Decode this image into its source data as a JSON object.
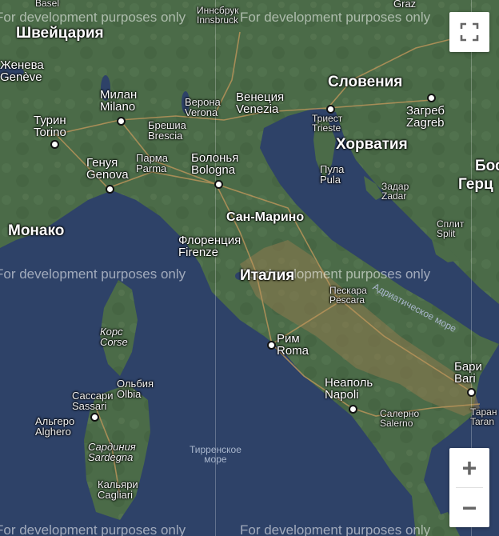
{
  "watermark": "For development purposes only",
  "countries": {
    "switzerland": "Швейцария",
    "slovenia": "Словения",
    "croatia": "Хорватия",
    "monaco": "Монако",
    "san_marino": "Сан-Марино",
    "italy": "Италия",
    "bosnia_part1": "Бос",
    "bosnia_part2": "Герц"
  },
  "cities": {
    "basel": "Basel",
    "innsbruck_ru": "Иннсбрук",
    "innsbruck": "Innsbruck",
    "graz": "Graz",
    "geneva_ru": "Женева",
    "geneva": "Genève",
    "milan_ru": "Милан",
    "milan": "Milano",
    "verona_ru": "Верона",
    "verona": "Verona",
    "venice_ru": "Венеция",
    "venice": "Venezia",
    "turin_ru": "Турин",
    "turin": "Torino",
    "brescia_ru": "Брешиа",
    "brescia": "Brescia",
    "trieste_ru": "Триест",
    "trieste": "Trieste",
    "zagreb_ru": "Загреб",
    "zagreb": "Zagreb",
    "genoa_ru": "Генуя",
    "genoa": "Genova",
    "parma_ru": "Парма",
    "parma": "Parma",
    "bologna_ru": "Болонья",
    "bologna": "Bologna",
    "pula_ru": "Пула",
    "pula": "Pula",
    "zadar_ru": "Задар",
    "zadar": "Zadar",
    "split_ru": "Сплит",
    "split": "Split",
    "florence_ru": "Флоренция",
    "florence": "Firenze",
    "pescara_ru": "Пескара",
    "pescara": "Pescara",
    "corsica_ru": "Корс",
    "corsica": "Corse",
    "rome_ru": "Рим",
    "rome": "Roma",
    "bari_ru": "Бари",
    "bari": "Bari",
    "olbia_ru": "Ольбия",
    "olbia": "Olbia",
    "sassari_ru": "Сассари",
    "sassari": "Sassari",
    "naples_ru": "Неаполь",
    "naples": "Napoli",
    "salerno_ru": "Салерно",
    "salerno": "Salerno",
    "taranto_ru": "Таран",
    "taranto": "Taran",
    "alghero_ru": "Альгеро",
    "alghero": "Alghero",
    "sardinia_ru": "Сардиния",
    "sardinia": "Sardegna",
    "cagliari_ru": "Кальяри",
    "cagliari": "Cagliari"
  },
  "seas": {
    "tyrrhenian_1": "Тирренское",
    "tyrrhenian_2": "море",
    "adriatic": "Адриатическое море"
  },
  "controls": {
    "fullscreen_icon": "fullscreen-icon",
    "zoom_in": "+",
    "zoom_out": "−"
  },
  "colors": {
    "sea": "#2e4268",
    "land": "#4a6a47",
    "roads": "#b8935a"
  }
}
